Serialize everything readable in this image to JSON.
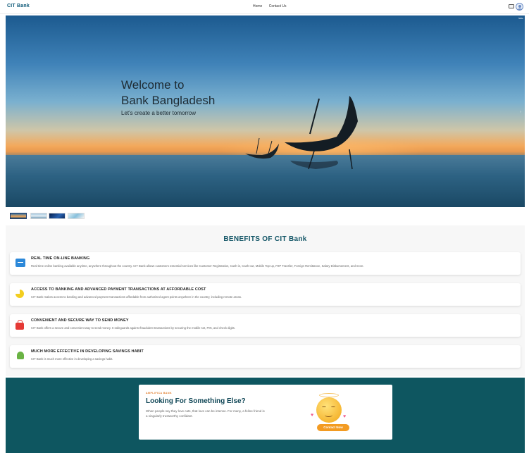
{
  "navbar": {
    "logo": "CIT Bank",
    "links": [
      "Home",
      "Contact Us"
    ]
  },
  "hero": {
    "title_line1": "Welcome to",
    "title_line2": "Bank Bangladesh",
    "subtitle": "Let's create a better tomorrow",
    "corner_label": "Slide",
    "slide_count": 4,
    "active_slide": 1
  },
  "benefits": {
    "title": "BENEFITS OF CIT Bank",
    "items": [
      {
        "icon": "banking-card-icon",
        "title": "REAL TIME ON-LINE BANKING",
        "desc": "Real-time online banking available anytime, anywhere throughout the country. CIT Bank allows customers essential services like Customer Registration, Cash-in, Cash-out, Mobile Top-up, P2P Transfer, Foreign Remittance, Salary Disbursement, and more."
      },
      {
        "icon": "pie-chart-icon",
        "title": "ACCESS TO BANKING AND ADVANCED PAYMENT TRANSACTIONS AT AFFORDABLE COST",
        "desc": "CIT Bank makes access to banking and advanced payment transactions affordable from authorized agent points anywhere in the country, including remote areas."
      },
      {
        "icon": "lock-icon",
        "title": "CONVENIENT AND SECURE WAY TO SEND MONEY",
        "desc": "CIT Bank offers a secure and convenient way to send money. It safeguards against fraudulent transactions by securing the mobile set, PIN, and check digits."
      },
      {
        "icon": "android-icon",
        "title": "MUCH MORE EFFECTIVE IN DEVELOPING SAVINGS HABIT",
        "desc": "CIT Bank is much more effective in developing a savings habit."
      }
    ]
  },
  "contact": {
    "kicker": "AMPLIFICA BANK",
    "title": "Looking For Something Else?",
    "text": "When people say they love cats, that love can be intense. For many, a feline friend is a singularly trustworthy confidant.",
    "button": "Contact Now"
  }
}
